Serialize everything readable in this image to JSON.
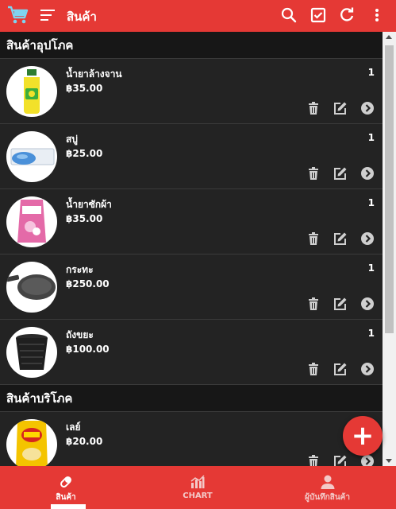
{
  "header": {
    "title": "สินค้า",
    "icons": [
      "cart-icon",
      "sort-icon",
      "search-icon",
      "checkbox-icon",
      "refresh-icon",
      "more-vert-icon"
    ]
  },
  "sections": [
    {
      "title": "สินค้าอุปโภค",
      "items": [
        {
          "name": "น้ำยาล้างจาน",
          "price": "฿35.00",
          "qty": "1",
          "image": "dish-soap-bottle"
        },
        {
          "name": "สบู่",
          "price": "฿25.00",
          "qty": "1",
          "image": "soap-bar"
        },
        {
          "name": "น้ำยาซักผ้า",
          "price": "฿35.00",
          "qty": "1",
          "image": "detergent-pouch"
        },
        {
          "name": "กระทะ",
          "price": "฿250.00",
          "qty": "1",
          "image": "frying-pan"
        },
        {
          "name": "ถังขยะ",
          "price": "฿100.00",
          "qty": "1",
          "image": "trash-bin"
        }
      ]
    },
    {
      "title": "สินค้าบริโภค",
      "items": [
        {
          "name": "เลย์",
          "price": "฿20.00",
          "qty": "",
          "image": "chips-bag"
        }
      ]
    }
  ],
  "fab": {
    "label": "+"
  },
  "bottom_nav": [
    {
      "label": "สินค้า",
      "icon": "pill-icon",
      "active": true
    },
    {
      "label": "CHART",
      "icon": "bar-chart-icon",
      "active": false
    },
    {
      "label": "ผู้บันทึกสินค้า",
      "icon": "person-icon",
      "active": false
    }
  ],
  "colors": {
    "accent": "#e53935",
    "background": "#1d1d1d",
    "row": "#232323",
    "icon": "#cfcfcf"
  }
}
